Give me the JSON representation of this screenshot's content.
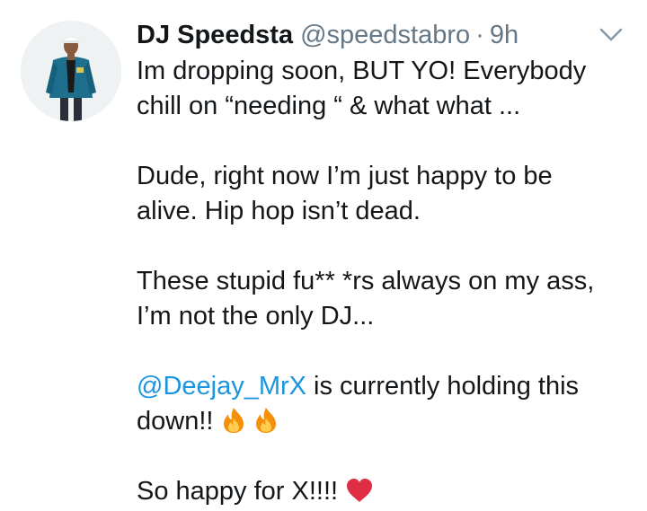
{
  "tweet": {
    "author": {
      "display_name": "DJ Speedsta",
      "handle": "@speedstabro",
      "separator": "·",
      "time": "9h",
      "avatar_icon": "profile-photo"
    },
    "menu_icon": "chevron-down-icon",
    "paragraphs": {
      "p1": {
        "line1": "Im dropping soon, BUT YO! Everybody",
        "line2": "chill on “needing “ & what what ..."
      },
      "p2": {
        "line1": "Dude, right now I’m just happy to be",
        "line2": "alive. Hip hop isn’t dead."
      },
      "p3": {
        "line1": "These stupid fu** *rs always on my ass,",
        "line2": "I’m not the only DJ..."
      },
      "p4": {
        "mention": "@Deejay_MrX",
        "line1_rest": " is currently holding this",
        "line2": "down!! ",
        "emojis": [
          "fire-emoji",
          "fire-emoji"
        ]
      },
      "p5": {
        "line1": "So happy for X!!!! ",
        "emoji": "red-heart-emoji"
      }
    },
    "colors": {
      "text": "#14171a",
      "secondary": "#657786",
      "link": "#1b95e0",
      "background": "#ffffff"
    }
  }
}
